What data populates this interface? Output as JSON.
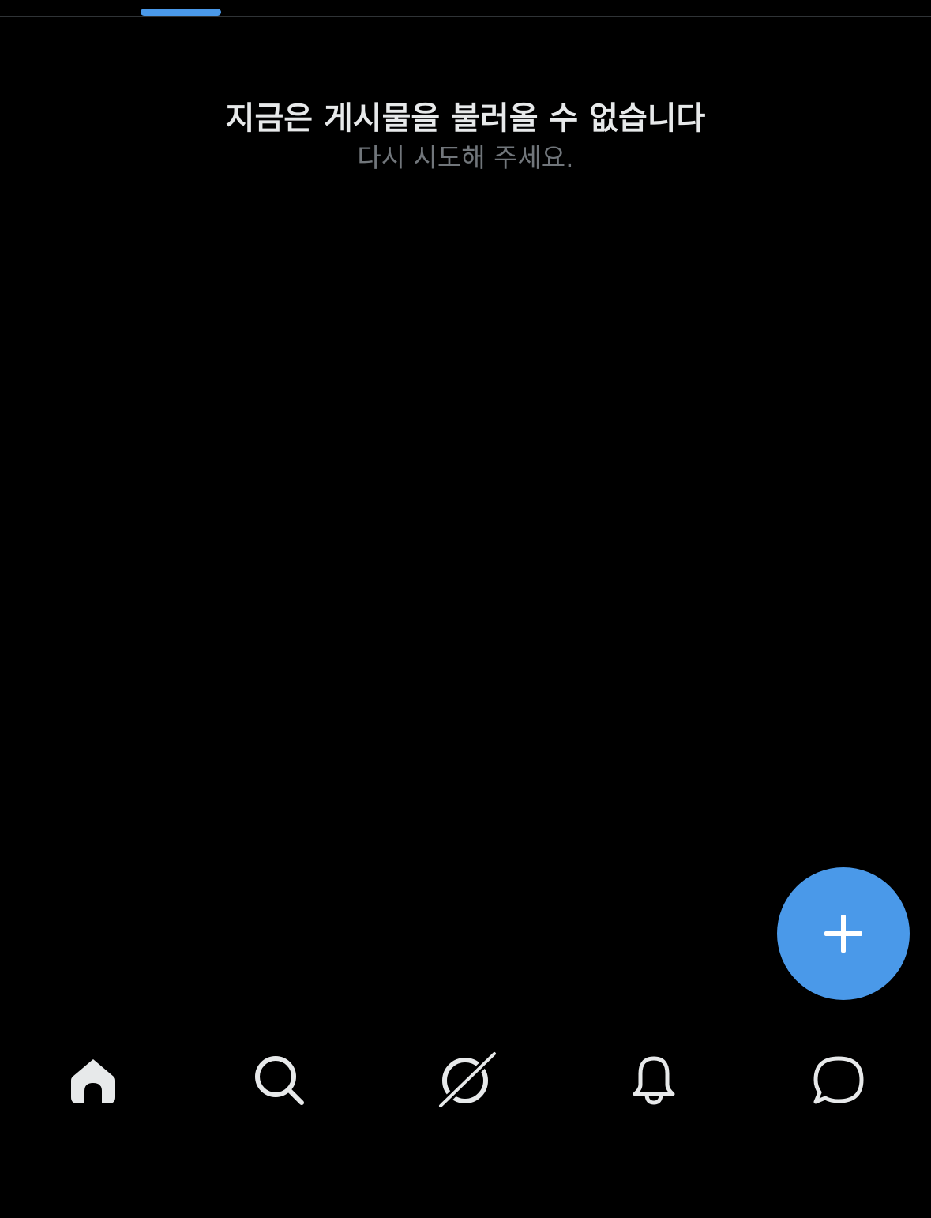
{
  "tabs": {
    "active_index": 0,
    "indicator_color": "#4a99e9"
  },
  "message": {
    "title": "지금은 게시물을 불러올 수 없습니다",
    "subtitle": "다시 시도해 주세요."
  },
  "fab": {
    "icon": "plus-icon",
    "color": "#4a99e9"
  },
  "bottom_nav": {
    "items": [
      {
        "icon": "home-icon",
        "active": true
      },
      {
        "icon": "search-icon",
        "active": false
      },
      {
        "icon": "grok-icon",
        "active": false
      },
      {
        "icon": "bell-icon",
        "active": false
      },
      {
        "icon": "chat-bubble-icon",
        "active": false
      }
    ]
  },
  "colors": {
    "background": "#000000",
    "text_primary": "#e7e9ea",
    "text_secondary": "#71767b",
    "divider": "#2f3336",
    "accent": "#4a99e9"
  }
}
